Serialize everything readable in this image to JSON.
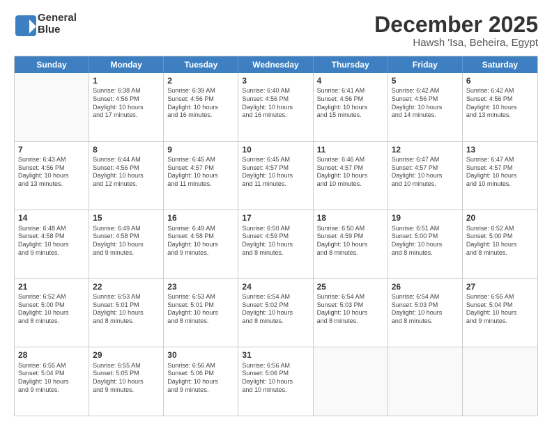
{
  "logo": {
    "line1": "General",
    "line2": "Blue"
  },
  "title": "December 2025",
  "subtitle": "Hawsh 'Isa, Beheira, Egypt",
  "weekdays": [
    "Sunday",
    "Monday",
    "Tuesday",
    "Wednesday",
    "Thursday",
    "Friday",
    "Saturday"
  ],
  "weeks": [
    [
      {
        "day": "",
        "info": ""
      },
      {
        "day": "1",
        "info": "Sunrise: 6:38 AM\nSunset: 4:56 PM\nDaylight: 10 hours\nand 17 minutes."
      },
      {
        "day": "2",
        "info": "Sunrise: 6:39 AM\nSunset: 4:56 PM\nDaylight: 10 hours\nand 16 minutes."
      },
      {
        "day": "3",
        "info": "Sunrise: 6:40 AM\nSunset: 4:56 PM\nDaylight: 10 hours\nand 16 minutes."
      },
      {
        "day": "4",
        "info": "Sunrise: 6:41 AM\nSunset: 4:56 PM\nDaylight: 10 hours\nand 15 minutes."
      },
      {
        "day": "5",
        "info": "Sunrise: 6:42 AM\nSunset: 4:56 PM\nDaylight: 10 hours\nand 14 minutes."
      },
      {
        "day": "6",
        "info": "Sunrise: 6:42 AM\nSunset: 4:56 PM\nDaylight: 10 hours\nand 13 minutes."
      }
    ],
    [
      {
        "day": "7",
        "info": "Sunrise: 6:43 AM\nSunset: 4:56 PM\nDaylight: 10 hours\nand 13 minutes."
      },
      {
        "day": "8",
        "info": "Sunrise: 6:44 AM\nSunset: 4:56 PM\nDaylight: 10 hours\nand 12 minutes."
      },
      {
        "day": "9",
        "info": "Sunrise: 6:45 AM\nSunset: 4:57 PM\nDaylight: 10 hours\nand 11 minutes."
      },
      {
        "day": "10",
        "info": "Sunrise: 6:45 AM\nSunset: 4:57 PM\nDaylight: 10 hours\nand 11 minutes."
      },
      {
        "day": "11",
        "info": "Sunrise: 6:46 AM\nSunset: 4:57 PM\nDaylight: 10 hours\nand 10 minutes."
      },
      {
        "day": "12",
        "info": "Sunrise: 6:47 AM\nSunset: 4:57 PM\nDaylight: 10 hours\nand 10 minutes."
      },
      {
        "day": "13",
        "info": "Sunrise: 6:47 AM\nSunset: 4:57 PM\nDaylight: 10 hours\nand 10 minutes."
      }
    ],
    [
      {
        "day": "14",
        "info": "Sunrise: 6:48 AM\nSunset: 4:58 PM\nDaylight: 10 hours\nand 9 minutes."
      },
      {
        "day": "15",
        "info": "Sunrise: 6:49 AM\nSunset: 4:58 PM\nDaylight: 10 hours\nand 9 minutes."
      },
      {
        "day": "16",
        "info": "Sunrise: 6:49 AM\nSunset: 4:58 PM\nDaylight: 10 hours\nand 9 minutes."
      },
      {
        "day": "17",
        "info": "Sunrise: 6:50 AM\nSunset: 4:59 PM\nDaylight: 10 hours\nand 8 minutes."
      },
      {
        "day": "18",
        "info": "Sunrise: 6:50 AM\nSunset: 4:59 PM\nDaylight: 10 hours\nand 8 minutes."
      },
      {
        "day": "19",
        "info": "Sunrise: 6:51 AM\nSunset: 5:00 PM\nDaylight: 10 hours\nand 8 minutes."
      },
      {
        "day": "20",
        "info": "Sunrise: 6:52 AM\nSunset: 5:00 PM\nDaylight: 10 hours\nand 8 minutes."
      }
    ],
    [
      {
        "day": "21",
        "info": "Sunrise: 6:52 AM\nSunset: 5:00 PM\nDaylight: 10 hours\nand 8 minutes."
      },
      {
        "day": "22",
        "info": "Sunrise: 6:53 AM\nSunset: 5:01 PM\nDaylight: 10 hours\nand 8 minutes."
      },
      {
        "day": "23",
        "info": "Sunrise: 6:53 AM\nSunset: 5:01 PM\nDaylight: 10 hours\nand 8 minutes."
      },
      {
        "day": "24",
        "info": "Sunrise: 6:54 AM\nSunset: 5:02 PM\nDaylight: 10 hours\nand 8 minutes."
      },
      {
        "day": "25",
        "info": "Sunrise: 6:54 AM\nSunset: 5:03 PM\nDaylight: 10 hours\nand 8 minutes."
      },
      {
        "day": "26",
        "info": "Sunrise: 6:54 AM\nSunset: 5:03 PM\nDaylight: 10 hours\nand 8 minutes."
      },
      {
        "day": "27",
        "info": "Sunrise: 6:55 AM\nSunset: 5:04 PM\nDaylight: 10 hours\nand 9 minutes."
      }
    ],
    [
      {
        "day": "28",
        "info": "Sunrise: 6:55 AM\nSunset: 5:04 PM\nDaylight: 10 hours\nand 9 minutes."
      },
      {
        "day": "29",
        "info": "Sunrise: 6:55 AM\nSunset: 5:05 PM\nDaylight: 10 hours\nand 9 minutes."
      },
      {
        "day": "30",
        "info": "Sunrise: 6:56 AM\nSunset: 5:06 PM\nDaylight: 10 hours\nand 9 minutes."
      },
      {
        "day": "31",
        "info": "Sunrise: 6:56 AM\nSunset: 5:06 PM\nDaylight: 10 hours\nand 10 minutes."
      },
      {
        "day": "",
        "info": ""
      },
      {
        "day": "",
        "info": ""
      },
      {
        "day": "",
        "info": ""
      }
    ]
  ]
}
